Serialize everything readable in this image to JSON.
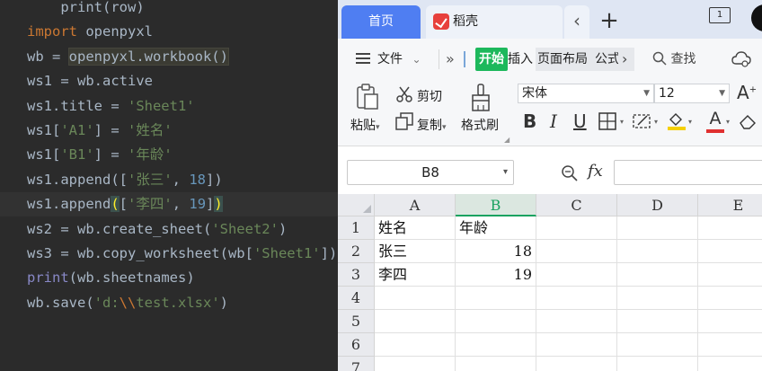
{
  "editor": {
    "lines": [
      {
        "segments": [
          {
            "t": "    print(row)",
            "c": ""
          }
        ]
      },
      {
        "segments": [
          {
            "t": "import",
            "c": "kw"
          },
          {
            "t": " openpyxl",
            "c": ""
          }
        ]
      },
      {
        "segments": [
          {
            "t": "wb = ",
            "c": ""
          },
          {
            "t": "openpyxl.workbook()",
            "c": "hl"
          }
        ]
      },
      {
        "segments": [
          {
            "t": "ws1 = wb.active",
            "c": ""
          }
        ]
      },
      {
        "segments": [
          {
            "t": "ws1.title = ",
            "c": ""
          },
          {
            "t": "'Sheet1'",
            "c": "str"
          }
        ]
      },
      {
        "segments": [
          {
            "t": "ws1[",
            "c": ""
          },
          {
            "t": "'A1'",
            "c": "str"
          },
          {
            "t": "] = ",
            "c": ""
          },
          {
            "t": "'姓名'",
            "c": "str"
          }
        ]
      },
      {
        "segments": [
          {
            "t": "ws1[",
            "c": ""
          },
          {
            "t": "'B1'",
            "c": "str"
          },
          {
            "t": "] = ",
            "c": ""
          },
          {
            "t": "'年龄'",
            "c": "str"
          }
        ]
      },
      {
        "segments": [
          {
            "t": "ws1.append([",
            "c": ""
          },
          {
            "t": "'张三'",
            "c": "str"
          },
          {
            "t": ", ",
            "c": ""
          },
          {
            "t": "18",
            "c": "num"
          },
          {
            "t": "])",
            "c": ""
          }
        ]
      },
      {
        "segments": [
          {
            "t": "ws1.append",
            "c": ""
          },
          {
            "t": "(",
            "c": "br"
          },
          {
            "t": "[",
            "c": ""
          },
          {
            "t": "'李四'",
            "c": "str"
          },
          {
            "t": ", ",
            "c": ""
          },
          {
            "t": "19",
            "c": "num"
          },
          {
            "t": "]",
            "c": ""
          },
          {
            "t": ")",
            "c": "br"
          }
        ],
        "current": true
      },
      {
        "segments": [
          {
            "t": "ws2 = wb.create_sheet(",
            "c": ""
          },
          {
            "t": "'Sheet2'",
            "c": "str"
          },
          {
            "t": ")",
            "c": ""
          }
        ]
      },
      {
        "segments": [
          {
            "t": "ws3 = wb.copy_worksheet(wb[",
            "c": ""
          },
          {
            "t": "'Sheet1'",
            "c": "str"
          },
          {
            "t": "])",
            "c": ""
          }
        ]
      },
      {
        "segments": [
          {
            "t": "print",
            "c": "bi"
          },
          {
            "t": "(wb.sheetnames)",
            "c": ""
          }
        ]
      },
      {
        "segments": [
          {
            "t": "wb.save(",
            "c": ""
          },
          {
            "t": "'d:",
            "c": "str"
          },
          {
            "t": "\\\\",
            "c": "kw"
          },
          {
            "t": "test.xlsx'",
            "c": "str"
          },
          {
            "t": ")",
            "c": ""
          }
        ]
      }
    ]
  },
  "tabs": {
    "home": "首页",
    "document": "稻壳",
    "scroll_glyph": "‹",
    "add_glyph": "+",
    "window_count": "1"
  },
  "menu": {
    "file": "文件",
    "file_caret": "⌄",
    "expand": "»",
    "start": "开始",
    "insert": "插入",
    "page_layout": "页面布局",
    "formula_partial": "公式",
    "more": "›",
    "search": "查找"
  },
  "toolbar": {
    "paste": "粘贴",
    "cut": "剪切",
    "copy": "复制",
    "format_painter": "格式刷",
    "font_name": "宋体",
    "font_size": "12",
    "bold": "B",
    "italic": "I",
    "underline": "U",
    "font_color_letter": "A"
  },
  "formula_bar": {
    "cell_ref": "B8",
    "fx": "fx"
  },
  "sheet": {
    "columns": [
      "A",
      "B",
      "C",
      "D",
      "E"
    ],
    "active_column": "B",
    "rows": [
      "1",
      "2",
      "3",
      "4",
      "5",
      "6",
      "7"
    ],
    "cells": [
      {
        "row": 0,
        "col": 0,
        "v": "姓名"
      },
      {
        "row": 0,
        "col": 1,
        "v": "年龄"
      },
      {
        "row": 1,
        "col": 0,
        "v": "张三"
      },
      {
        "row": 1,
        "col": 1,
        "v": "18",
        "num": true
      },
      {
        "row": 2,
        "col": 0,
        "v": "李四"
      },
      {
        "row": 2,
        "col": 1,
        "v": "19",
        "num": true
      }
    ]
  },
  "colors": {
    "accent": "#4f7ef2",
    "start_green": "#1db85c",
    "active_col_green": "#1aa260",
    "font_color_red": "#e03030",
    "highlight_yellow": "#f5d000"
  }
}
